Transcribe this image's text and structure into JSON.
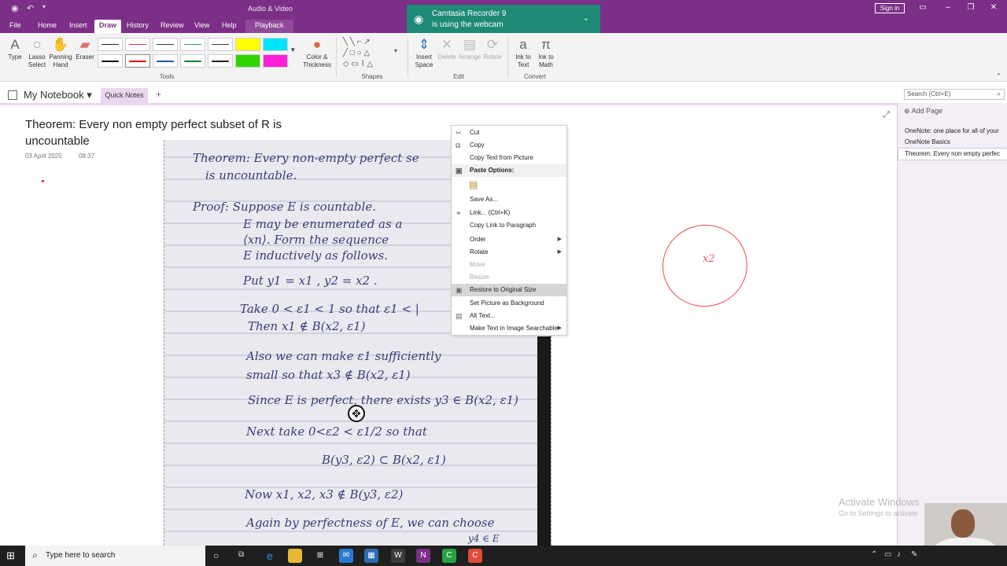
{
  "titlebar": {
    "context_label": "Audio & Video",
    "signin": "Sign in"
  },
  "tabs": [
    "File",
    "Home",
    "Insert",
    "Draw",
    "History",
    "Review",
    "View",
    "Help",
    "Playback"
  ],
  "ribbon": {
    "tools": [
      "Type",
      "Lasso Select",
      "Panning Hand",
      "Eraser"
    ],
    "color_thickness": "Color & Thickness",
    "edit_tools": [
      "Insert Space",
      "Delete",
      "Arrange",
      "Rotate"
    ],
    "convert_tools": [
      "Ink to Text",
      "Ink to Math"
    ],
    "groups": {
      "tools": "Tools",
      "shapes": "Shapes",
      "edit": "Edit",
      "convert": "Convert"
    }
  },
  "toast": {
    "line1": "Camtasia Recorder 9",
    "line2": "is using the webcam"
  },
  "notebook": {
    "name": "My Notebook",
    "section": "Quick Notes",
    "add": "+"
  },
  "search": {
    "placeholder": "Search (Ctrl+E)"
  },
  "panel": {
    "add_page": "Add Page",
    "pages": [
      "OneNote: one place for all of your",
      "OneNote Basics",
      "Theorem: Every non empty perfec"
    ]
  },
  "page": {
    "title": "Theorem: Every non empty perfect subset of R is uncountable",
    "date": "03 April 2020",
    "time": "08:37"
  },
  "handwriting": [
    "Theorem: Every non-empty perfect se",
    "is uncountable.",
    "Proof: Suppose E is countable.",
    "E may be enumerated as a",
    "⟨xn⟩. Form the sequence",
    "E inductively as follows.",
    "Put  y1 = x1 , y2 = x2 .",
    "Take 0 < ε1 < 1  so that  ε1 < |",
    "Then  x1 ∉ B(x2, ε1)",
    "Also we can make ε1 sufficiently",
    "small so that  x3 ∉ B(x2, ε1)",
    "Since E is perfect, there exists y3 ∈ B(x2, ε1)",
    "Next take 0<ε2 < ε1/2  so that",
    "B(y3, ε2) ⊂ B(x2, ε1)",
    "Now  x1, x2, x3 ∉ B(y3, ε2)",
    "Again by perfectness of E, we can choose",
    "y4 ∈ E"
  ],
  "annotation": {
    "text": "x2"
  },
  "context_menu": {
    "items": [
      {
        "label": "Cut",
        "icon": "✂",
        "state": "normal"
      },
      {
        "label": "Copy",
        "icon": "⧉",
        "state": "normal"
      },
      {
        "label": "Copy Text from Picture",
        "icon": "",
        "state": "normal"
      },
      {
        "label": "Paste Options:",
        "icon": "📋",
        "state": "header"
      },
      {
        "label": "",
        "icon": "📋",
        "state": "normal"
      },
      {
        "label": "Save As...",
        "icon": "",
        "state": "normal"
      },
      {
        "label": "Link...  (Ctrl+K)",
        "icon": "🔗",
        "state": "normal"
      },
      {
        "label": "Copy Link to Paragraph",
        "icon": "",
        "state": "normal"
      },
      {
        "label": "Order",
        "icon": "",
        "state": "sub"
      },
      {
        "label": "Rotate",
        "icon": "",
        "state": "sub"
      },
      {
        "label": "Move",
        "icon": "",
        "state": "disabled"
      },
      {
        "label": "Resize",
        "icon": "",
        "state": "disabled"
      },
      {
        "label": "Restore to Original Size",
        "icon": "▣",
        "state": "highlight"
      },
      {
        "label": "Set Picture as Background",
        "icon": "",
        "state": "normal"
      },
      {
        "label": "Alt Text...",
        "icon": "▤",
        "state": "normal"
      },
      {
        "label": "Make Text in Image Searchable",
        "icon": "",
        "state": "sub"
      }
    ]
  },
  "watermark": {
    "line1": "Activate Windows",
    "line2": "Go to Settings to activate"
  },
  "taskbar": {
    "search_placeholder": "Type here to search"
  }
}
